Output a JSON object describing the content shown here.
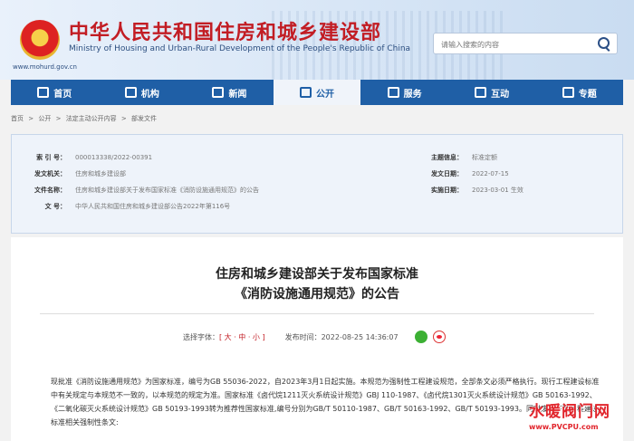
{
  "site": {
    "title": "中华人民共和国住房和城乡建设部",
    "subtitle": "Ministry of Housing and Urban-Rural Development of the People's Republic of China",
    "url": "www.mohurd.gov.cn",
    "search_placeholder": "请输入搜索的内容"
  },
  "nav": [
    {
      "label": "首页",
      "icon": "home-icon"
    },
    {
      "label": "机构",
      "icon": "building-icon"
    },
    {
      "label": "新闻",
      "icon": "newspaper-icon"
    },
    {
      "label": "公开",
      "icon": "document-icon",
      "active": true
    },
    {
      "label": "服务",
      "icon": "service-icon"
    },
    {
      "label": "互动",
      "icon": "chat-icon"
    },
    {
      "label": "专题",
      "icon": "topic-icon"
    }
  ],
  "breadcrumb": [
    "首页",
    ">",
    "公开",
    ">",
    "法定主动公开内容",
    ">",
    "部发文件"
  ],
  "info": {
    "index_label": "索 引 号：",
    "index": "000013338/2022-00391",
    "issuer_label": "发文机关：",
    "issuer": "住房和城乡建设部",
    "docname_label": "文件名称：",
    "docname": "住房和城乡建设部关于发布国家标准《消防设施通用规范》的公告",
    "docno_label": "文 号：",
    "docno": "中华人民共和国住房和城乡建设部公告2022年第116号",
    "topic_label": "主题信息：",
    "topic": "标准定额",
    "date_label": "发文日期：",
    "date": "2022-07-15",
    "effective_label": "实施日期：",
    "effective": "2023-03-01 生效"
  },
  "article": {
    "title_line1": "住房和城乡建设部关于发布国家标准",
    "title_line2": "《消防设施通用规范》的公告",
    "font_label": "选择字体：",
    "font_options": "[ 大 · 中 · 小 ]",
    "publish_label": "发布时间：",
    "publish_time": "2022-08-25 14:36:07",
    "paragraph": "现批准《消防设施通用规范》为国家标准，编号为GB 55036-2022，自2023年3月1日起实施。本规范为强制性工程建设规范，全部条文必须严格执行。现行工程建设标准中有关规定与本规范不一致的，以本规范的规定为准。国家标准《卤代烷1211灭火系统设计规范》GBJ 110-1987、《卤代烷1301灭火系统设计规范》GB 50163-1992、《二氧化碳灭火系统设计规范》GB 50193-1993转为推荐性国家标准,编号分别为GB/T 50110-1987、GB/T 50163-1992、GB/T 50193-1993。同时废止下列工程建设标准相关强制性条文:"
  },
  "watermark": {
    "line1": "水暖阀门网",
    "line2": "www.PVCPU.com"
  },
  "colors": {
    "nav": "#1f5fa6",
    "title_red": "#c21d24"
  }
}
